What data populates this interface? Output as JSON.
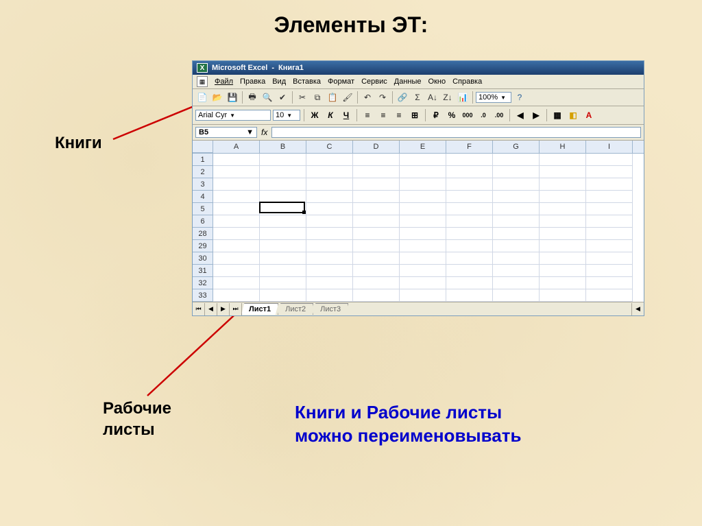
{
  "slide": {
    "title": "Элементы ЭТ:",
    "label_books": "Книги",
    "label_sheets_line1": "Рабочие",
    "label_sheets_line2": "листы",
    "label_rename_line1": "Книги и Рабочие листы",
    "label_rename_line2": "можно переименовывать"
  },
  "titlebar": {
    "app": "Microsoft Excel",
    "doc": "Книга1"
  },
  "menus": [
    "Файл",
    "Правка",
    "Вид",
    "Вставка",
    "Формат",
    "Сервис",
    "Данные",
    "Окно",
    "Справка"
  ],
  "format": {
    "font": "Arial Cyr",
    "size": "10",
    "zoom": "100%"
  },
  "namebox": "B5",
  "columns": [
    "A",
    "B",
    "C",
    "D",
    "E",
    "F",
    "G",
    "H",
    "I"
  ],
  "rows_visible": [
    "1",
    "2",
    "3",
    "4",
    "5",
    "6",
    "28",
    "29",
    "30",
    "31",
    "32",
    "33"
  ],
  "active_cell": {
    "col_index": 1,
    "row_index": 4
  },
  "sheets": [
    {
      "name": "Лист1",
      "active": true
    },
    {
      "name": "Лист2",
      "active": false
    },
    {
      "name": "Лист3",
      "active": false
    }
  ],
  "icons": {
    "new": "📄",
    "open": "📂",
    "save": "💾",
    "print": "🖶",
    "preview": "🔍",
    "spell": "✔",
    "cut": "✂",
    "copy": "⧉",
    "paste": "📋",
    "fmtpaint": "🖌",
    "undo": "↶",
    "redo": "↷",
    "link": "🔗",
    "sum": "Σ",
    "sortaz": "A↓",
    "sortza": "Z↓",
    "chart": "📊",
    "help": "?",
    "bold": "Ж",
    "italic": "К",
    "underline": "Ч",
    "alignl": "≡",
    "alignc": "≡",
    "alignr": "≡",
    "merge": "⊞",
    "currency": "₽",
    "percent": "%",
    "comma": "000",
    "decinc": ".0",
    "decdec": ".00",
    "indent_dec": "◀",
    "indent_inc": "▶",
    "borders": "▦",
    "fill": "◧",
    "fontcolor": "A"
  }
}
